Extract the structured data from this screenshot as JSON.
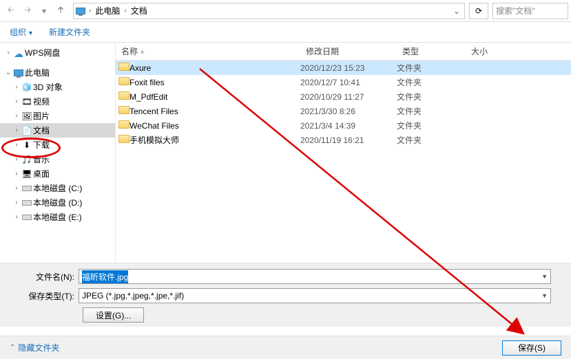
{
  "nav": {
    "dropdown": "▾"
  },
  "breadcrumb": {
    "loc1": "此电脑",
    "loc2": "文档"
  },
  "search": {
    "placeholder": "搜索\"文档\""
  },
  "toolbar": {
    "organize": "组织",
    "newfolder": "新建文件夹"
  },
  "sidebar": {
    "wps": "WPS网盘",
    "thispc": "此电脑",
    "items": [
      {
        "label": "3D 对象",
        "ico": "🧊"
      },
      {
        "label": "视频",
        "ico": "🎞"
      },
      {
        "label": "图片",
        "ico": "🖼"
      },
      {
        "label": "文档",
        "ico": "📄"
      },
      {
        "label": "下载",
        "ico": "⬇"
      },
      {
        "label": "音乐",
        "ico": "🎵"
      },
      {
        "label": "桌面",
        "ico": "🖥"
      },
      {
        "label": "本地磁盘 (C:)",
        "ico": "disk"
      },
      {
        "label": "本地磁盘 (D:)",
        "ico": "disk"
      },
      {
        "label": "本地磁盘 (E:)",
        "ico": "disk"
      }
    ]
  },
  "headers": {
    "name": "名称",
    "date": "修改日期",
    "type": "类型",
    "size": "大小"
  },
  "files": [
    {
      "name": "Axure",
      "date": "2020/12/23 15:23",
      "type": "文件夹",
      "sel": true
    },
    {
      "name": "Foxit files",
      "date": "2020/12/7 10:41",
      "type": "文件夹"
    },
    {
      "name": "M_PdfEdit",
      "date": "2020/10/29 11:27",
      "type": "文件夹"
    },
    {
      "name": "Tencent Files",
      "date": "2021/3/30 8:26",
      "type": "文件夹"
    },
    {
      "name": "WeChat Files",
      "date": "2021/3/4 14:39",
      "type": "文件夹"
    },
    {
      "name": "手机模拟大师",
      "date": "2020/11/19 16:21",
      "type": "文件夹"
    }
  ],
  "form": {
    "fname_label": "文件名(N):",
    "fname_value": "福昕软件.jpg",
    "ftype_label": "保存类型(T):",
    "ftype_value": "JPEG (*.jpg,*.jpeg,*.jpe,*.jif)",
    "settings": "设置(G)..."
  },
  "footer": {
    "hide": "隐藏文件夹",
    "save": "保存(S)"
  }
}
